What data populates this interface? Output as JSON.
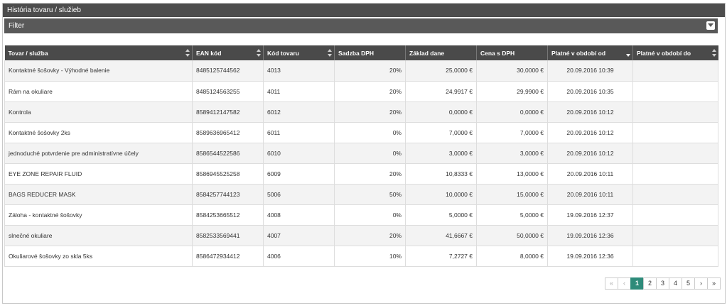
{
  "panel": {
    "title": "História tovaru / služieb"
  },
  "filter": {
    "label": "Filter",
    "toggle_icon": "chevron-down-square-icon"
  },
  "table": {
    "columns": [
      {
        "label": "Tovar / služba",
        "sort": "both"
      },
      {
        "label": "EAN kód",
        "sort": "both"
      },
      {
        "label": "Kód tovaru",
        "sort": "both"
      },
      {
        "label": "Sadzba DPH",
        "sort": "none"
      },
      {
        "label": "Základ dane",
        "sort": "none"
      },
      {
        "label": "Cena s DPH",
        "sort": "none"
      },
      {
        "label": "Platné v období od",
        "sort": "desc"
      },
      {
        "label": "Platné v období do",
        "sort": "both"
      }
    ],
    "rows": [
      [
        "Kontaktné šošovky - Výhodné balenie",
        "8485125744562",
        "4013",
        "20%",
        "25,0000 €",
        "30,0000 €",
        "20.09.2016 10:39",
        ""
      ],
      [
        "Rám na okuliare",
        "8485124563255",
        "4011",
        "20%",
        "24,9917 €",
        "29,9900 €",
        "20.09.2016 10:35",
        ""
      ],
      [
        "Kontrola",
        "8589412147582",
        "6012",
        "20%",
        "0,0000 €",
        "0,0000 €",
        "20.09.2016 10:12",
        ""
      ],
      [
        "Kontaktné šošovky 2ks",
        "8589636965412",
        "6011",
        "0%",
        "7,0000 €",
        "7,0000 €",
        "20.09.2016 10:12",
        ""
      ],
      [
        "jednoduché potvrdenie pre administratívne účely",
        "8586544522586",
        "6010",
        "0%",
        "3,0000 €",
        "3,0000 €",
        "20.09.2016 10:12",
        ""
      ],
      [
        "EYE ZONE REPAIR FLUID",
        "8586945525258",
        "6009",
        "20%",
        "10,8333 €",
        "13,0000 €",
        "20.09.2016 10:11",
        ""
      ],
      [
        "BAGS REDUCER MASK",
        "8584257744123",
        "5006",
        "50%",
        "10,0000 €",
        "15,0000 €",
        "20.09.2016 10:11",
        ""
      ],
      [
        "Záloha - kontaktné šošovky",
        "8584253665512",
        "4008",
        "0%",
        "5,0000 €",
        "5,0000 €",
        "19.09.2016 12:37",
        ""
      ],
      [
        "slnečné okuliare",
        "8582533569441",
        "4007",
        "20%",
        "41,6667 €",
        "50,0000 €",
        "19.09.2016 12:36",
        ""
      ],
      [
        "Okuliarové šošovky zo skla 5ks",
        "8586472934412",
        "4006",
        "10%",
        "7,2727 €",
        "8,0000 €",
        "19.09.2016 12:36",
        ""
      ]
    ]
  },
  "pagination": {
    "first": "«",
    "prev": "‹",
    "pages": [
      "1",
      "2",
      "3",
      "4",
      "5"
    ],
    "active": "1",
    "next": "›",
    "last": "»"
  },
  "colors": {
    "header_bg": "#4d4d4d",
    "active_page": "#2e8b7a"
  }
}
